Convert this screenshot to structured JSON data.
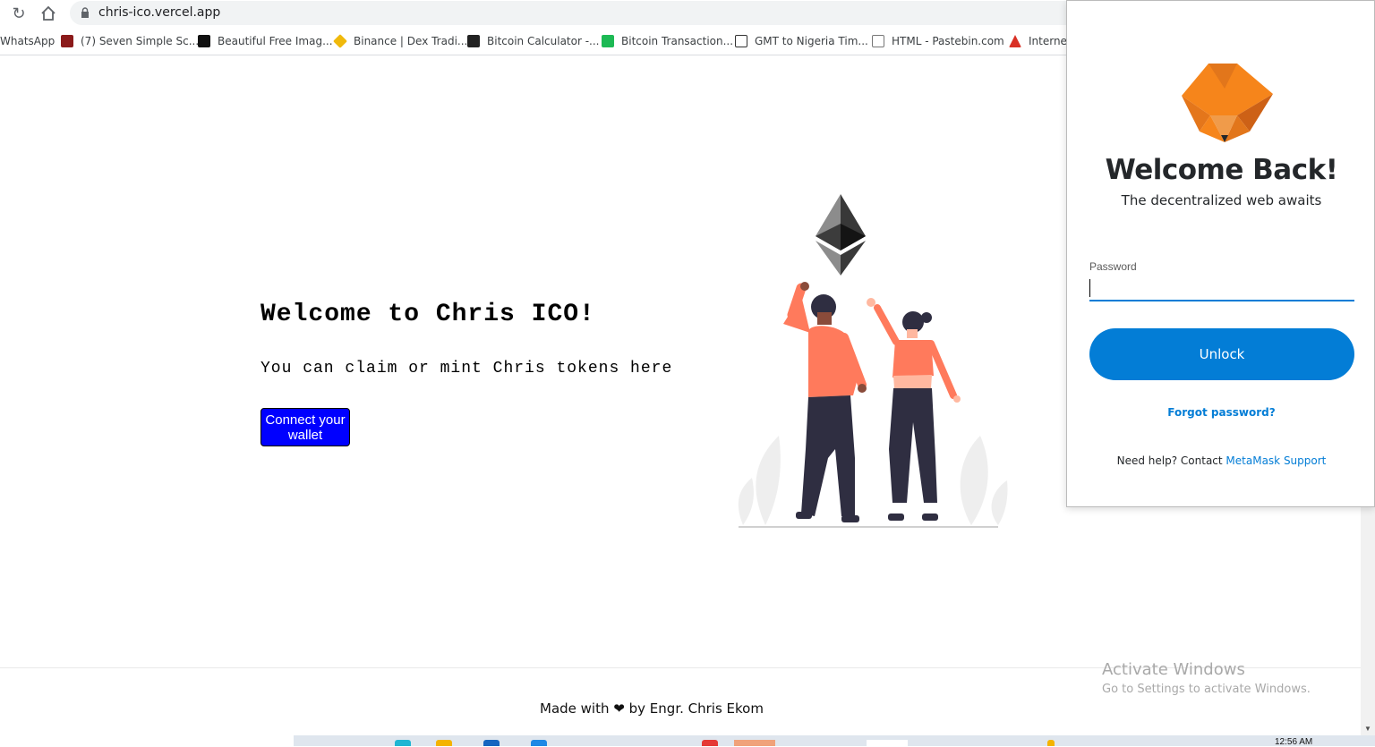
{
  "browser": {
    "url": "chris-ico.vercel.app",
    "bookmarks": [
      {
        "label": "WhatsApp",
        "icon": "whatsapp-icon",
        "color": "#25d366"
      },
      {
        "label": "(7) Seven Simple Sc...",
        "icon": "seven-icon",
        "color": "#8b1a1a"
      },
      {
        "label": "Beautiful Free Imag...",
        "icon": "unsplash-icon",
        "color": "#111111"
      },
      {
        "label": "Binance | Dex Tradi...",
        "icon": "binance-icon",
        "color": "#f0b90b"
      },
      {
        "label": "Bitcoin Calculator -...",
        "icon": "calculator-icon",
        "color": "#222222"
      },
      {
        "label": "Bitcoin Transaction...",
        "icon": "transaction-icon",
        "color": "#1db954"
      },
      {
        "label": "GMT to Nigeria Tim...",
        "icon": "timezone-icon",
        "color": "#555555"
      },
      {
        "label": "HTML - Pastebin.com",
        "icon": "pastebin-icon",
        "color": "#777777"
      },
      {
        "label": "Internet",
        "icon": "internet-icon",
        "color": "#d93025"
      }
    ]
  },
  "hero": {
    "title": "Welcome to Chris ICO!",
    "description": "You can claim or mint Chris tokens here",
    "connect_label": "Connect your wallet"
  },
  "footer": {
    "before": "Made with",
    "after": "by Engr. Chris Ekom"
  },
  "watermark": {
    "line1": "Activate Windows",
    "line2": "Go to Settings to activate Windows."
  },
  "taskbar": {
    "clock": "12:56 AM"
  },
  "metamask": {
    "title": "Welcome Back!",
    "subtitle": "The decentralized web awaits",
    "password_label": "Password",
    "password_value": "",
    "unlock_label": "Unlock",
    "forgot_label": "Forgot password?",
    "help_text": "Need help? Contact",
    "help_link": "MetaMask Support"
  },
  "colors": {
    "accent_blue": "#037dd6",
    "connect_button": "#0000ff",
    "person_shirt": "#ff7a5c",
    "person_pants": "#2f2e41"
  }
}
